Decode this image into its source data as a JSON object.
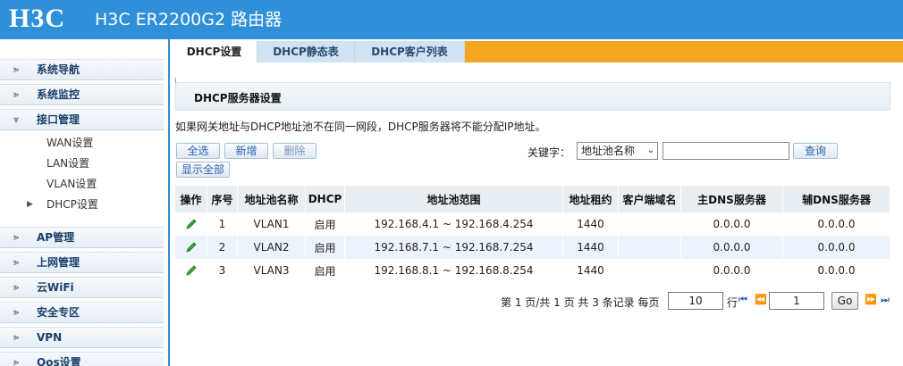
{
  "header": {
    "logo": "H3C",
    "title": "H3C ER2200G2 路由器"
  },
  "sidebar": {
    "items": [
      {
        "label": "系统导航",
        "icon": "expand-arrow-icon"
      },
      {
        "label": "系统监控",
        "icon": "expand-arrow-icon"
      },
      {
        "label": "接口管理",
        "icon": "collapse-arrow-icon"
      },
      {
        "label": "AP管理",
        "icon": "expand-arrow-icon"
      },
      {
        "label": "上网管理",
        "icon": "expand-arrow-icon"
      },
      {
        "label": "云WiFi",
        "icon": "expand-arrow-icon"
      },
      {
        "label": "安全专区",
        "icon": "expand-arrow-icon"
      },
      {
        "label": "VPN",
        "icon": "expand-arrow-icon"
      },
      {
        "label": "Qos设置",
        "icon": "expand-arrow-icon"
      }
    ],
    "sub_items": [
      "WAN设置",
      "LAN设置",
      "VLAN设置",
      "DHCP设置"
    ],
    "selected_sub": "DHCP设置"
  },
  "tabs": [
    {
      "label": "DHCP设置",
      "active": true
    },
    {
      "label": "DHCP静态表",
      "active": false
    },
    {
      "label": "DHCP客户列表",
      "active": false
    }
  ],
  "panel": {
    "title": "DHCP服务器设置",
    "notice": "如果网关地址与DHCP地址池不在同一网段，DHCP服务器将不能分配IP地址。"
  },
  "toolbar": {
    "select_all": "全选",
    "add": "新增",
    "delete": "删除",
    "show_all": "显示全部",
    "keyword_label": "关键字：",
    "keyword_select": "地址池名称",
    "keyword_value": "",
    "search": "查询"
  },
  "table": {
    "headers": [
      "操作",
      "序号",
      "地址池名称",
      "DHCP",
      "地址池范围",
      "地址租约",
      "客户端域名",
      "主DNS服务器",
      "辅DNS服务器"
    ],
    "rows": [
      {
        "index": "1",
        "name": "VLAN1",
        "dhcp": "启用",
        "range": "192.168.4.1 ~ 192.168.4.254",
        "lease": "1440",
        "domain": "",
        "dns1": "0.0.0.0",
        "dns2": "0.0.0.0"
      },
      {
        "index": "2",
        "name": "VLAN2",
        "dhcp": "启用",
        "range": "192.168.7.1 ~ 192.168.7.254",
        "lease": "1440",
        "domain": "",
        "dns1": "0.0.0.0",
        "dns2": "0.0.0.0"
      },
      {
        "index": "3",
        "name": "VLAN3",
        "dhcp": "启用",
        "range": "192.168.8.1 ~ 192.168.8.254",
        "lease": "1440",
        "domain": "",
        "dns1": "0.0.0.0",
        "dns2": "0.0.0.0"
      }
    ]
  },
  "pager": {
    "summary": "第 1 页/共 1 页 共 3 条记录 每页",
    "per_page": "10",
    "row_unit": "行",
    "page_input": "1",
    "go": "Go"
  },
  "colors": {
    "header_bg": "#2f8fd8",
    "tab_accent": "#f5a623",
    "link_blue": "#2a5db0"
  }
}
